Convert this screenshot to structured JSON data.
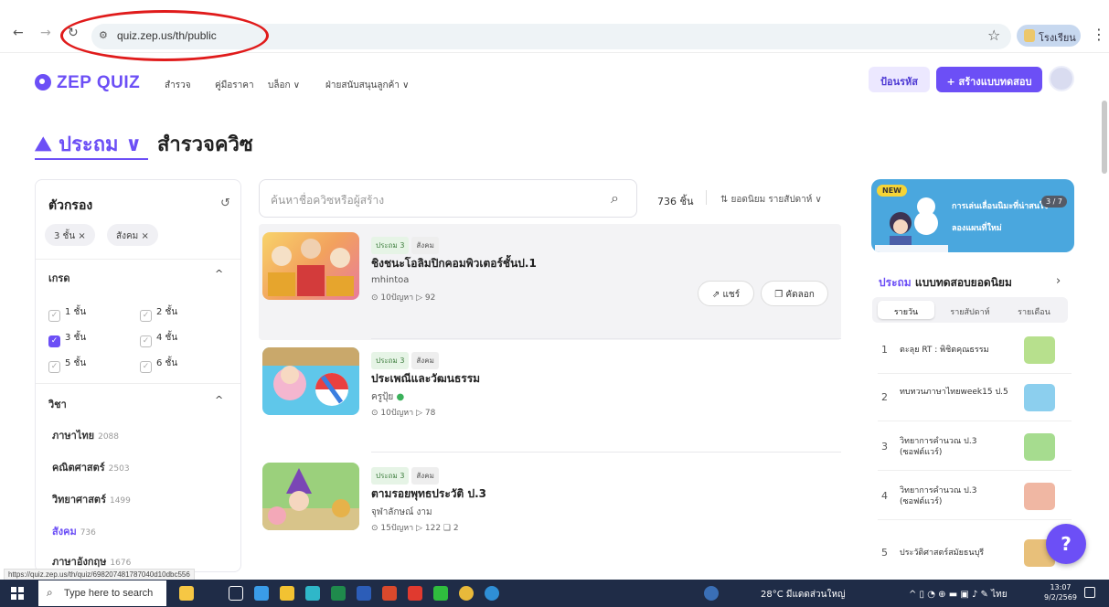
{
  "browser": {
    "url": "quiz.zep.us/th/public",
    "profile_label": "โรงเรียน",
    "status_url": "https://quiz.zep.us/th/quiz/698207481787040d10dbc556"
  },
  "header": {
    "logo": "ZEP QUIZ",
    "nav": [
      "สำรวจ",
      "คู่มือราคา",
      "บล็อก ∨",
      "ฝ่ายสนับสนุนลูกค้า ∨"
    ],
    "join_label": "ป้อนรหัส",
    "create_label": "+ สร้างแบบทดสอบ"
  },
  "page": {
    "grade_select": "⛰ ประถม ∨",
    "title": "สำรวจควิซ"
  },
  "filter": {
    "title": "ตัวกรอง",
    "chips": [
      "3 ชั้น ×",
      "สังคม ×"
    ],
    "grade_title": "เกรด",
    "grades": [
      {
        "label": "1 ชั้น",
        "checked": false
      },
      {
        "label": "2 ชั้น",
        "checked": false
      },
      {
        "label": "3 ชั้น",
        "checked": true
      },
      {
        "label": "4 ชั้น",
        "checked": false
      },
      {
        "label": "5 ชั้น",
        "checked": false
      },
      {
        "label": "6 ชั้น",
        "checked": false
      }
    ],
    "subject_title": "วิชา",
    "subjects": [
      {
        "label": "ภาษาไทย",
        "count": "2088"
      },
      {
        "label": "คณิตศาสตร์",
        "count": "2503"
      },
      {
        "label": "วิทยาศาสตร์",
        "count": "1499"
      },
      {
        "label": "สังคม",
        "count": "736"
      },
      {
        "label": "ภาษาอังกฤษ",
        "count": "1676"
      }
    ]
  },
  "search": {
    "placeholder": "ค้นหาชื่อควิซหรือผู้สร้าง",
    "count": "736 ชิ้น",
    "sort": "⇅ ยอดนิยม รายสัปดาห์ ∨"
  },
  "quizzes": [
    {
      "tags": [
        "ประถม 3",
        "สังคม"
      ],
      "title": "ชิงชนะโอลิมปิกคอมพิวเตอร์ชั้นป.1",
      "author": "mhintoa",
      "meta": "⊙ 10ปัญหา   ▷ 92",
      "share": "แชร์",
      "copy": "คัดลอก"
    },
    {
      "tags": [
        "ประถม 3",
        "สังคม"
      ],
      "title": "ประเพณีและวัฒนธรรม",
      "author": "ครูปุ้ย",
      "meta": "⊙ 10ปัญหา   ▷ 78"
    },
    {
      "tags": [
        "ประถม 3",
        "สังคม"
      ],
      "title": "ตามรอยพุทธประวัติ ป.3",
      "author": "จุฬาลักษณ์ งาม",
      "meta": "⊙ 15ปัญหา   ▷ 122   ❑ 2"
    }
  ],
  "banner": {
    "new": "NEW",
    "line1": "การเล่นเลื่อนนิมะที่น่าสนใจ",
    "line2": "ลองแผนที่ใหม่",
    "page": "3 / 7"
  },
  "popular": {
    "title_grade": "ประถม",
    "title_rest": " แบบทดสอบยอดนิยม",
    "tabs": [
      "รายวัน",
      "รายสัปดาห์",
      "รายเดือน"
    ],
    "items": [
      {
        "rank": "1",
        "name": "ตะลุย RT : พิชิตคุณธรรม"
      },
      {
        "rank": "2",
        "name": "ทบทวนภาษาไทยweek15 ป.5"
      },
      {
        "rank": "3",
        "name": "วิทยาการคำนวณ ป.3 (ซอฟต์แวร์)"
      },
      {
        "rank": "4",
        "name": "วิทยาการคำนวณ ป.3 (ซอฟต์แวร์)"
      },
      {
        "rank": "5",
        "name": "ประวัติศาสตร์สมัยธนบุรี"
      }
    ]
  },
  "taskbar": {
    "search_placeholder": "Type here to search",
    "weather": "28°C มีแดดส่วนใหญ่",
    "lang": "ไทย",
    "time": "13:07",
    "date": "9/2/2569"
  },
  "colors": {
    "accent": "#6c4ff6",
    "annotation": "#e01b1b"
  }
}
